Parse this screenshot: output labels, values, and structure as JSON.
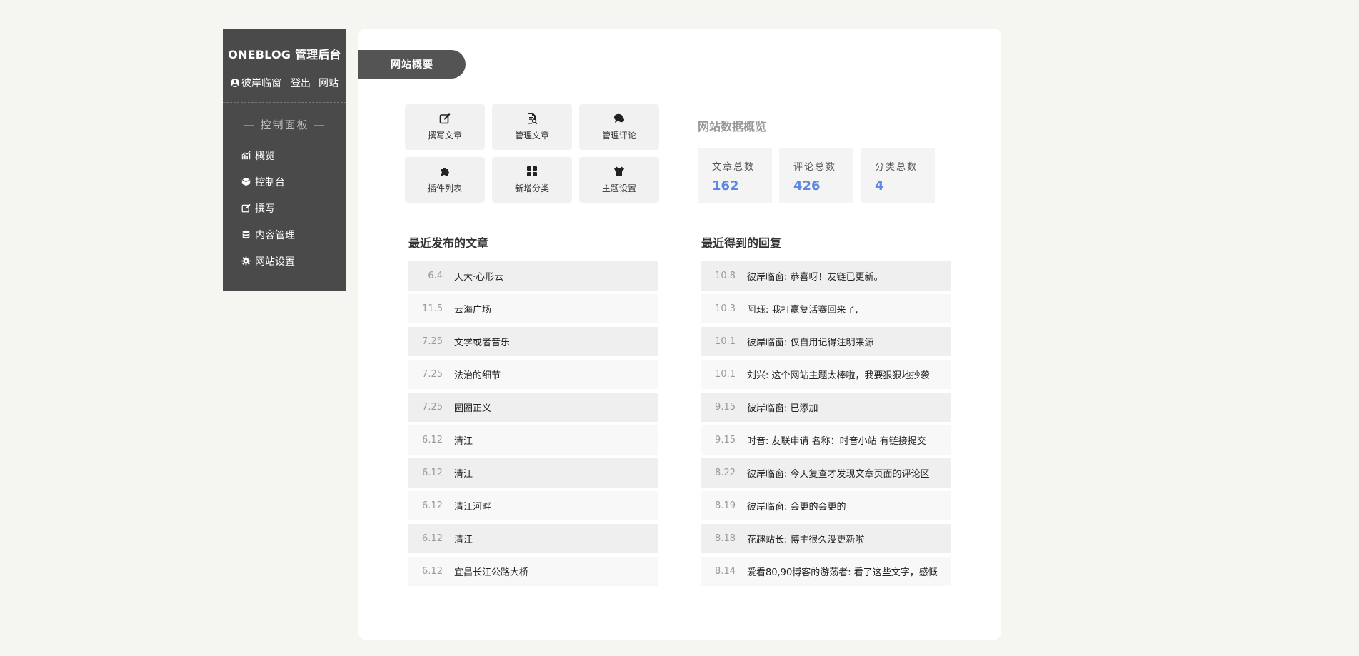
{
  "sidebar": {
    "brand": "ONEBLOG 管理后台",
    "user": "彼岸临窗",
    "logout": "登出",
    "site": "网站",
    "panel_title": "— 控制面板 —",
    "menu": [
      {
        "label": "概览",
        "icon": "chart-icon"
      },
      {
        "label": "控制台",
        "icon": "cube-icon"
      },
      {
        "label": "撰写",
        "icon": "edit-icon"
      },
      {
        "label": "内容管理",
        "icon": "database-icon"
      },
      {
        "label": "网站设置",
        "icon": "gear-icon"
      }
    ]
  },
  "main": {
    "tab": "网站概要",
    "quick": [
      {
        "label": "撰写文章",
        "icon": "edit-icon"
      },
      {
        "label": "管理文章",
        "icon": "file-search-icon"
      },
      {
        "label": "管理评论",
        "icon": "comments-icon"
      },
      {
        "label": "插件列表",
        "icon": "puzzle-icon"
      },
      {
        "label": "新增分类",
        "icon": "grid-icon"
      },
      {
        "label": "主题设置",
        "icon": "shirt-icon"
      }
    ],
    "stats_title": "网站数据概览",
    "stats": [
      {
        "label": "文章总数",
        "value": "162"
      },
      {
        "label": "评论总数",
        "value": "426"
      },
      {
        "label": "分类总数",
        "value": "4"
      }
    ],
    "posts_title": "最近发布的文章",
    "posts": [
      {
        "date": "6.4",
        "title": "天大·心形云"
      },
      {
        "date": "11.5",
        "title": "云海广场"
      },
      {
        "date": "7.25",
        "title": "文学或者音乐"
      },
      {
        "date": "7.25",
        "title": "法治的细节"
      },
      {
        "date": "7.25",
        "title": "圆圈正义"
      },
      {
        "date": "6.12",
        "title": "清江"
      },
      {
        "date": "6.12",
        "title": "清江"
      },
      {
        "date": "6.12",
        "title": "清江河畔"
      },
      {
        "date": "6.12",
        "title": "清江"
      },
      {
        "date": "6.12",
        "title": "宜昌长江公路大桥"
      }
    ],
    "replies_title": "最近得到的回复",
    "replies": [
      {
        "date": "10.8",
        "text": "彼岸临窗: 恭喜呀！友链已更新。"
      },
      {
        "date": "10.3",
        "text": "阿珏: 我打赢复活赛回来了,"
      },
      {
        "date": "10.1",
        "text": "彼岸临窗: 仅自用记得注明来源"
      },
      {
        "date": "10.1",
        "text": "刘兴: 这个网站主题太棒啦，我要狠狠地抄袭"
      },
      {
        "date": "9.15",
        "text": "彼岸临窗: 已添加"
      },
      {
        "date": "9.15",
        "text": "时音: 友联申请 名称：时音小站 有链接提交"
      },
      {
        "date": "8.22",
        "text": "彼岸临窗: 今天复查才发现文章页面的评论区"
      },
      {
        "date": "8.19",
        "text": "彼岸临窗: 会更的会更的"
      },
      {
        "date": "8.18",
        "text": "花趣站长: 博主很久没更新啦"
      },
      {
        "date": "8.14",
        "text": "爱看80,90博客的游荡者: 看了这些文字，感慨"
      }
    ]
  }
}
